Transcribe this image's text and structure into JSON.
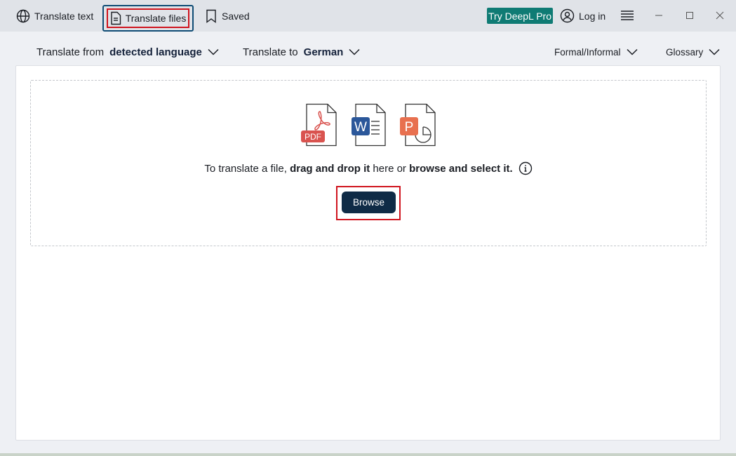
{
  "titlebar": {
    "nav": [
      {
        "label": "Translate text",
        "icon": "globe-icon"
      },
      {
        "label": "Translate files",
        "icon": "document-icon",
        "active": true
      },
      {
        "label": "Saved",
        "icon": "bookmark-icon"
      }
    ],
    "pro_button": "Try DeepL Pro",
    "login": {
      "label": "Log in",
      "icon": "user-circle-icon"
    },
    "menu_icon": "hamburger-menu-icon",
    "window_controls": [
      "minimize",
      "maximize",
      "close"
    ]
  },
  "options": {
    "from_prefix": "Translate from",
    "from_value": "detected language",
    "to_prefix": "Translate to",
    "to_value": "German",
    "formality": "Formal/Informal",
    "glossary": "Glossary"
  },
  "dropzone": {
    "file_types": [
      "PDF",
      "W",
      "P"
    ],
    "hint_1": "To translate a file, ",
    "hint_bold_1": "drag and drop it",
    "hint_2": " here or ",
    "hint_bold_2": "browse and select it.",
    "browse_label": "Browse"
  },
  "colors": {
    "accent_pro": "#0f7b74",
    "browse_bg": "#0f2b46",
    "pdf_red": "#d9534f",
    "word_blue": "#2b579a",
    "ppt_orange": "#e8704f",
    "highlight_red": "#d0141e"
  }
}
